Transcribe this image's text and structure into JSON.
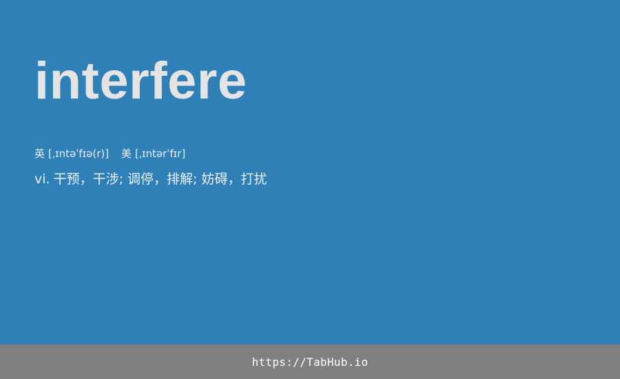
{
  "card": {
    "word": "interfere",
    "phonetics": {
      "uk_label": "英",
      "uk_ipa": "[ˌɪntəˈfɪə(r)]",
      "us_label": "美",
      "us_ipa": "[ˌɪntərˈfɪr]"
    },
    "definition": {
      "pos": "vi.",
      "text": "干预，干涉; 调停，排解; 妨碍，打扰"
    }
  },
  "footer": {
    "link_text": "https://TabHub.io"
  },
  "colors": {
    "background": "#3080b8",
    "footer_bg": "#808080",
    "word_text": "#e4e4e4"
  }
}
